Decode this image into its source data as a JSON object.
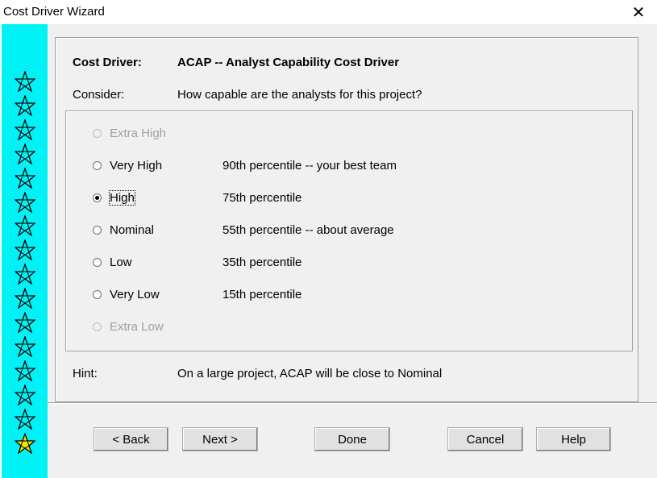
{
  "window": {
    "title": "Cost Driver Wizard",
    "close_glyph": "✕"
  },
  "star_strip": {
    "background": "#00f2f7",
    "stars": 16,
    "current_star_color": "#f5e400",
    "icon": "star-icon"
  },
  "driver": {
    "label": "Cost Driver:",
    "value": "ACAP -- Analyst Capability Cost Driver",
    "consider_label": "Consider:",
    "consider_text": "How capable are the analysts for this project?"
  },
  "ratings": [
    {
      "label": "Extra High",
      "desc": "",
      "enabled": false,
      "selected": false
    },
    {
      "label": "Very High",
      "desc": "90th percentile -- your best team",
      "enabled": true,
      "selected": false
    },
    {
      "label": "High",
      "desc": "75th percentile",
      "enabled": true,
      "selected": true
    },
    {
      "label": "Nominal",
      "desc": "55th percentile -- about average",
      "enabled": true,
      "selected": false
    },
    {
      "label": "Low",
      "desc": "35th percentile",
      "enabled": true,
      "selected": false
    },
    {
      "label": "Very Low",
      "desc": "15th percentile",
      "enabled": true,
      "selected": false
    },
    {
      "label": "Extra Low",
      "desc": "",
      "enabled": false,
      "selected": false
    }
  ],
  "hint": {
    "label": "Hint:",
    "text": "On a large project, ACAP will be close to Nominal"
  },
  "buttons": {
    "back": "< Back",
    "next": "Next >",
    "done": "Done",
    "cancel": "Cancel",
    "help": "Help"
  }
}
